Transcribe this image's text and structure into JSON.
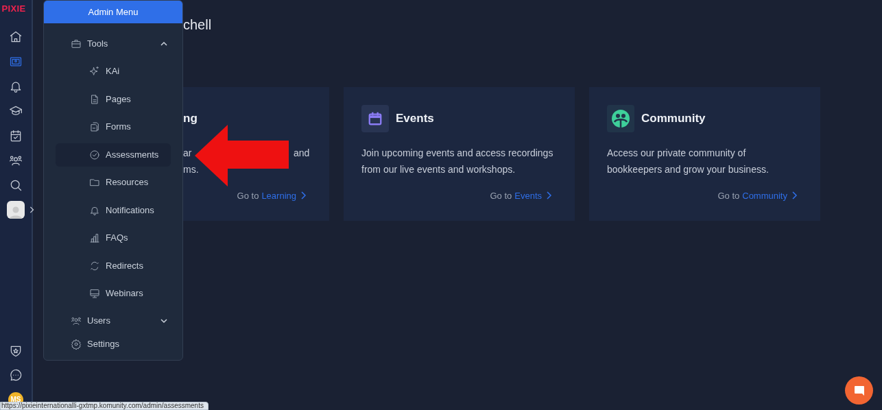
{
  "rail": {
    "logo": "PIXIE",
    "items": [
      {
        "kind": "home",
        "selected": false
      },
      {
        "kind": "spaces",
        "selected": true
      },
      {
        "kind": "bell",
        "selected": false
      },
      {
        "kind": "cap",
        "selected": false
      },
      {
        "kind": "calendar",
        "selected": false
      },
      {
        "kind": "people",
        "selected": false
      },
      {
        "kind": "search",
        "selected": false
      }
    ],
    "bottom_items": [
      {
        "kind": "shield"
      },
      {
        "kind": "chat"
      }
    ],
    "user_initials": "MS"
  },
  "admin_menu": {
    "title": "Admin Menu",
    "groups": [
      {
        "label": "Tools",
        "kind": "briefcase",
        "expanded": true,
        "children": [
          {
            "label": "KAi",
            "kind": "sparkle",
            "selected": false
          },
          {
            "label": "Pages",
            "kind": "page",
            "selected": false
          },
          {
            "label": "Forms",
            "kind": "forms",
            "selected": false
          },
          {
            "label": "Assessments",
            "kind": "check",
            "selected": true
          },
          {
            "label": "Resources",
            "kind": "folder",
            "selected": false
          },
          {
            "label": "Notifications",
            "kind": "bell",
            "selected": false
          },
          {
            "label": "FAQs",
            "kind": "bars",
            "selected": false
          },
          {
            "label": "Redirects",
            "kind": "refresh",
            "selected": false
          },
          {
            "label": "Webinars",
            "kind": "monitor",
            "selected": false
          }
        ]
      },
      {
        "label": "Users",
        "kind": "people",
        "expanded": false
      },
      {
        "label": "Settings",
        "kind": "gear"
      }
    ]
  },
  "main": {
    "heading": "chell",
    "cards": [
      {
        "kind": "partial",
        "title": "ng",
        "description_parts": [
          "ar",
          "and",
          "ms."
        ],
        "link_prefix": "Go to",
        "link": "Learning"
      },
      {
        "kind": "events",
        "title": "Events",
        "description": "Join upcoming events and access recordings from our live events and workshops.",
        "link_prefix": "Go to",
        "link": "Events"
      },
      {
        "kind": "community",
        "title": "Community",
        "description": "Access our private community of bookkeepers and grow your business.",
        "link_prefix": "Go to",
        "link": "Community"
      }
    ]
  },
  "status_url": "https://pixieinternationalli-gxtmp.komunity.com/admin/assessments"
}
